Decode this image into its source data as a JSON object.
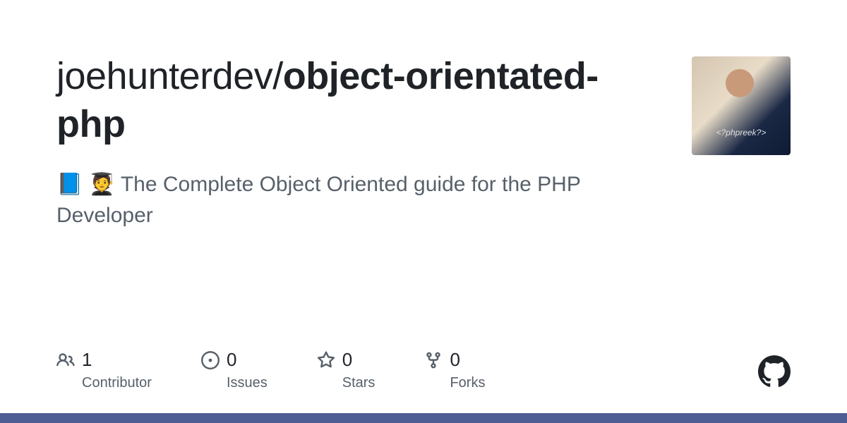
{
  "repo": {
    "owner": "joehunterdev",
    "separator": "/",
    "name": "object-orientated-php",
    "description": "📘 🧑‍🎓 The Complete Object Oriented guide for the PHP Developer"
  },
  "stats": [
    {
      "count": "1",
      "label": "Contributor"
    },
    {
      "count": "0",
      "label": "Issues"
    },
    {
      "count": "0",
      "label": "Stars"
    },
    {
      "count": "0",
      "label": "Forks"
    }
  ],
  "avatar": {
    "shirt_text": "<?phpreek?>"
  },
  "language_bar_color": "#4f5d95"
}
